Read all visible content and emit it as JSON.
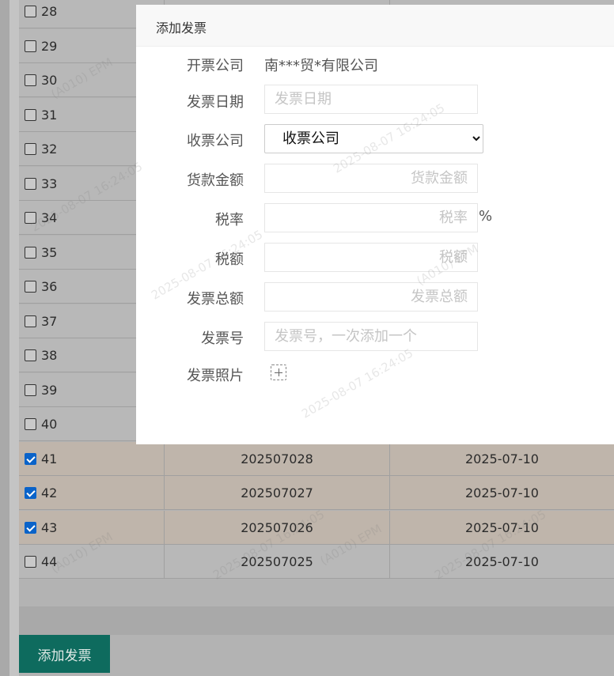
{
  "table": {
    "rows": [
      {
        "num": "28",
        "code": "",
        "date": "",
        "checked": false
      },
      {
        "num": "29",
        "code": "",
        "date": "",
        "checked": false
      },
      {
        "num": "30",
        "code": "",
        "date": "",
        "checked": false
      },
      {
        "num": "31",
        "code": "",
        "date": "",
        "checked": false
      },
      {
        "num": "32",
        "code": "",
        "date": "",
        "checked": false
      },
      {
        "num": "33",
        "code": "",
        "date": "",
        "checked": false
      },
      {
        "num": "34",
        "code": "",
        "date": "",
        "checked": false
      },
      {
        "num": "35",
        "code": "",
        "date": "",
        "checked": false
      },
      {
        "num": "36",
        "code": "",
        "date": "",
        "checked": false
      },
      {
        "num": "37",
        "code": "",
        "date": "",
        "checked": false
      },
      {
        "num": "38",
        "code": "",
        "date": "",
        "checked": false
      },
      {
        "num": "39",
        "code": "",
        "date": "",
        "checked": false
      },
      {
        "num": "40",
        "code": "",
        "date": "",
        "checked": false
      },
      {
        "num": "41",
        "code": "202507028",
        "date": "2025-07-10",
        "checked": true
      },
      {
        "num": "42",
        "code": "202507027",
        "date": "2025-07-10",
        "checked": true
      },
      {
        "num": "43",
        "code": "202507026",
        "date": "2025-07-10",
        "checked": true
      },
      {
        "num": "44",
        "code": "202507025",
        "date": "2025-07-10",
        "checked": false
      }
    ]
  },
  "page": {
    "add_invoice_button": "添加发票"
  },
  "modal": {
    "title": "添加发票",
    "issuer_label": "开票公司",
    "issuer_value": "南***贸*有限公司",
    "date_label": "发票日期",
    "date_placeholder": "发票日期",
    "payee_label": "收票公司",
    "payee_selected": "收票公司",
    "amount_label": "货款金额",
    "amount_placeholder": "货款金额",
    "tax_rate_label": "税率",
    "tax_rate_placeholder": "税率",
    "tax_rate_unit": "%",
    "tax_amount_label": "税额",
    "tax_amount_placeholder": "税额",
    "total_label": "发票总额",
    "total_placeholder": "发票总额",
    "invoice_no_label": "发票号",
    "invoice_no_placeholder": "发票号，一次添加一个",
    "photo_label": "发票照片",
    "upload_icon": "plus-upload-icon"
  },
  "watermark": {
    "line1": "(A010) EPM",
    "line2": "2025-08-07 16:24:05"
  }
}
